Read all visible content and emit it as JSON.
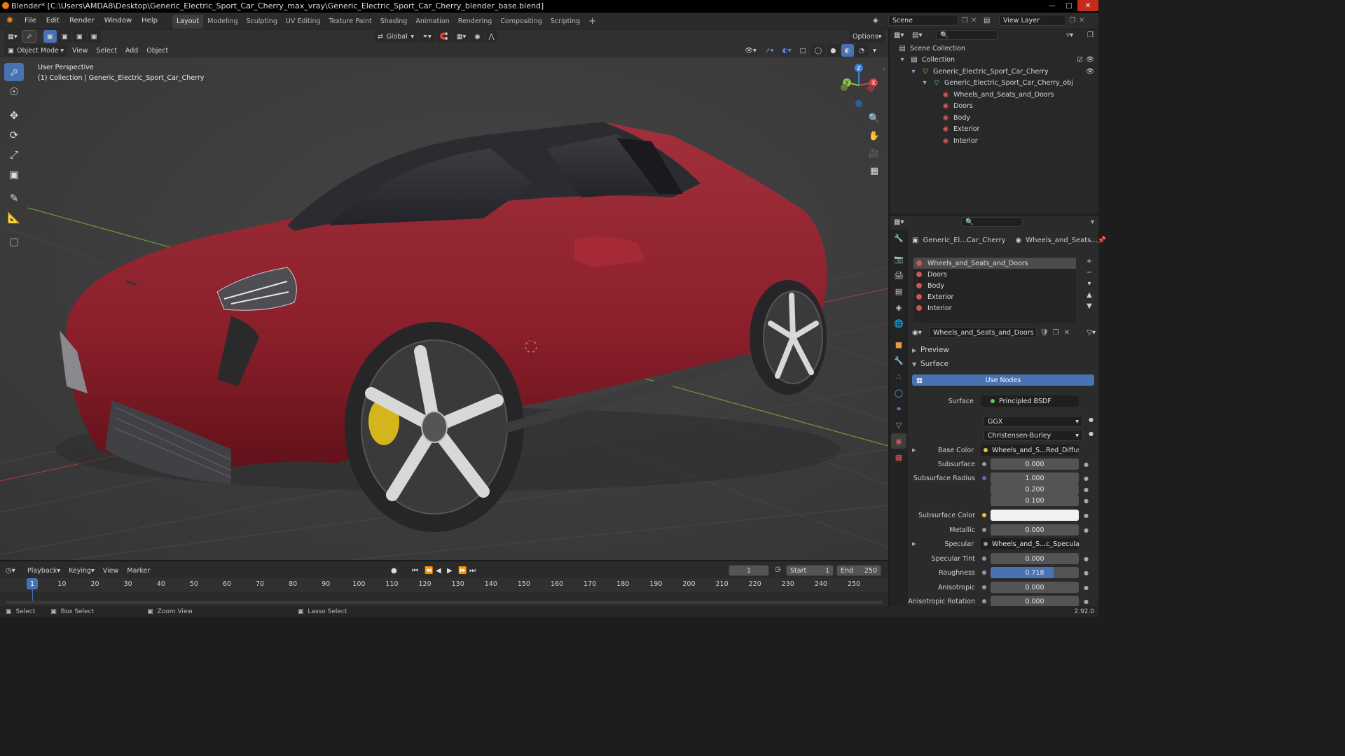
{
  "window": {
    "title": "Blender* [C:\\Users\\AMDA8\\Desktop\\Generic_Electric_Sport_Car_Cherry_max_vray\\Generic_Electric_Sport_Car_Cherry_blender_base.blend]"
  },
  "menu": [
    "File",
    "Edit",
    "Render",
    "Window",
    "Help"
  ],
  "workspaces": [
    "Layout",
    "Modeling",
    "Sculpting",
    "UV Editing",
    "Texture Paint",
    "Shading",
    "Animation",
    "Rendering",
    "Compositing",
    "Scripting"
  ],
  "scene": {
    "name": "Scene",
    "view_layer": "View Layer"
  },
  "viewport_header": {
    "orientation": "Global",
    "options": "Options",
    "mode": "Object Mode",
    "menus": [
      "View",
      "Select",
      "Add",
      "Object"
    ]
  },
  "viewport": {
    "perspective": "User Perspective",
    "collection_info": "(1) Collection | Generic_Electric_Sport_Car_Cherry",
    "gizmo": {
      "x": "X",
      "y": "Y",
      "z": "Z"
    }
  },
  "outliner": {
    "scene_collection": "Scene Collection",
    "collection": "Collection",
    "object": "Generic_Electric_Sport_Car_Cherry",
    "mesh": "Generic_Electric_Sport_Car_Cherry_obj",
    "materials": [
      "Wheels_and_Seats_and_Doors",
      "Doors",
      "Body",
      "Exterior",
      "Interior"
    ]
  },
  "properties": {
    "breadcrumb_object": "Generic_El...Car_Cherry",
    "breadcrumb_material": "Wheels_and_Seats...",
    "slots": [
      "Wheels_and_Seats_and_Doors",
      "Doors",
      "Body",
      "Exterior",
      "Interior"
    ],
    "material_name": "Wheels_and_Seats_and_Doors",
    "preview_label": "Preview",
    "surface_label": "Surface",
    "use_nodes": "Use Nodes",
    "surface_shader": "Principled BSDF",
    "distribution": "GGX",
    "subsurface_method": "Christensen-Burley",
    "rows": {
      "base_color": {
        "label": "Base Color",
        "value": "Wheels_and_S...Red_Diffuse.pn"
      },
      "subsurface": {
        "label": "Subsurface",
        "value": "0.000"
      },
      "subsurface_radius": {
        "label": "Subsurface Radius",
        "values": [
          "1.000",
          "0.200",
          "0.100"
        ]
      },
      "subsurface_color": {
        "label": "Subsurface Color"
      },
      "metallic": {
        "label": "Metallic",
        "value": "0.000"
      },
      "specular": {
        "label": "Specular",
        "value": "Wheels_and_S...c_Specular.png"
      },
      "specular_tint": {
        "label": "Specular Tint",
        "value": "0.000"
      },
      "roughness": {
        "label": "Roughness",
        "value": "0.718",
        "fraction": 0.718
      },
      "anisotropic": {
        "label": "Anisotropic",
        "value": "0.000"
      },
      "anisotropic_rotation": {
        "label": "Anisotropic Rotation",
        "value": "0.000"
      }
    }
  },
  "timeline": {
    "menus": [
      "Playback",
      "Keying",
      "View",
      "Marker"
    ],
    "current_frame": "1",
    "start_label": "Start",
    "start": "1",
    "end_label": "End",
    "end": "250",
    "ticks": [
      "1",
      "10",
      "20",
      "30",
      "40",
      "50",
      "60",
      "70",
      "80",
      "90",
      "100",
      "110",
      "120",
      "130",
      "140",
      "150",
      "160",
      "170",
      "180",
      "190",
      "200",
      "210",
      "220",
      "230",
      "240",
      "250"
    ]
  },
  "statusbar": {
    "select": "Select",
    "box_select": "Box Select",
    "zoom_view": "Zoom View",
    "lasso_select": "Lasso Select",
    "version": "2.92.0"
  },
  "colors": {
    "accent": "#4772b3",
    "car_body": "#8e1f2c",
    "caliper": "#d4b51c",
    "x_axis": "#d9423f",
    "y_axis": "#8cc43e",
    "z_axis": "#3d82d8"
  }
}
